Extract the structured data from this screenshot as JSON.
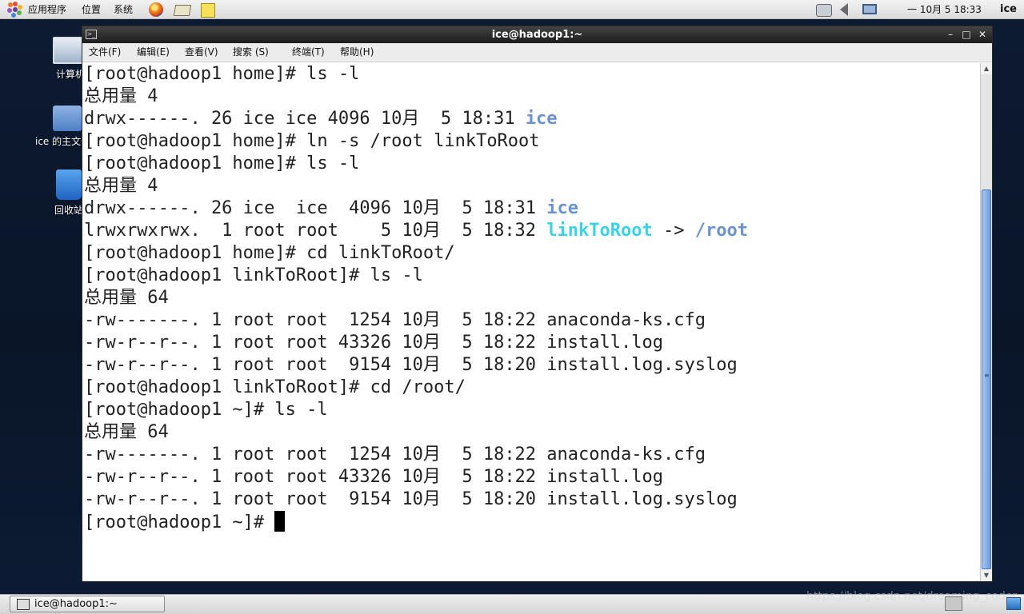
{
  "top_panel": {
    "menus": [
      "应用程序",
      "位置",
      "系统"
    ],
    "clock": "一 10月   5 18:33",
    "user": "ice"
  },
  "desktop": {
    "icons": [
      {
        "label": "计算机",
        "icon": "computer-icon"
      },
      {
        "label": "ice 的主文件夹",
        "icon": "home-folder-icon"
      },
      {
        "label": "回收站",
        "icon": "trash-icon"
      }
    ]
  },
  "window": {
    "title": "ice@hadoop1:~",
    "controls": {
      "minimize": "–",
      "maximize": "□",
      "close": "✕"
    },
    "menu": [
      "文件(F)",
      "编辑(E)",
      "查看(V)",
      "搜索 (S)",
      "终端(T)",
      "帮助(H)"
    ]
  },
  "terminal": {
    "colors": {
      "directory": "#6c93d1",
      "symlink": "#3ad3e6",
      "text": "#222222"
    },
    "lines": [
      {
        "text": "[root@hadoop1 home]# ls -l"
      },
      {
        "text": "总用量 4"
      },
      {
        "text": "drwx------. 26 ice ice 4096 10月  5 18:31 ",
        "name": "ice",
        "name_class": "dir"
      },
      {
        "text": "[root@hadoop1 home]# ln -s /root linkToRoot"
      },
      {
        "text": "[root@hadoop1 home]# ls -l"
      },
      {
        "text": "总用量 4"
      },
      {
        "text": "drwx------. 26 ice  ice  4096 10月  5 18:31 ",
        "name": "ice",
        "name_class": "dir"
      },
      {
        "text": "lrwxrwxrwx.  1 root root    5 10月  5 18:32 ",
        "name": "linkToRoot",
        "name_class": "link",
        "arrow": " -> ",
        "target": "/root"
      },
      {
        "text": "[root@hadoop1 home]# cd linkToRoot/"
      },
      {
        "text": "[root@hadoop1 linkToRoot]# ls -l"
      },
      {
        "text": "总用量 64"
      },
      {
        "text": "-rw-------. 1 root root  1254 10月  5 18:22 anaconda-ks.cfg"
      },
      {
        "text": "-rw-r--r--. 1 root root 43326 10月  5 18:22 install.log"
      },
      {
        "text": "-rw-r--r--. 1 root root  9154 10月  5 18:20 install.log.syslog"
      },
      {
        "text": "[root@hadoop1 linkToRoot]# cd /root/"
      },
      {
        "text": "[root@hadoop1 ~]# ls -l"
      },
      {
        "text": "总用量 64"
      },
      {
        "text": "-rw-------. 1 root root  1254 10月  5 18:22 anaconda-ks.cfg"
      },
      {
        "text": "-rw-r--r--. 1 root root 43326 10月  5 18:22 install.log"
      },
      {
        "text": "-rw-r--r--. 1 root root  9154 10月  5 18:20 install.log.syslog"
      },
      {
        "text": "[root@hadoop1 ~]# ",
        "cursor": true
      }
    ]
  },
  "taskbar": {
    "task_label": "ice@hadoop1:~",
    "watermark": "https://blog.csdn.net/dreaming_coder"
  }
}
